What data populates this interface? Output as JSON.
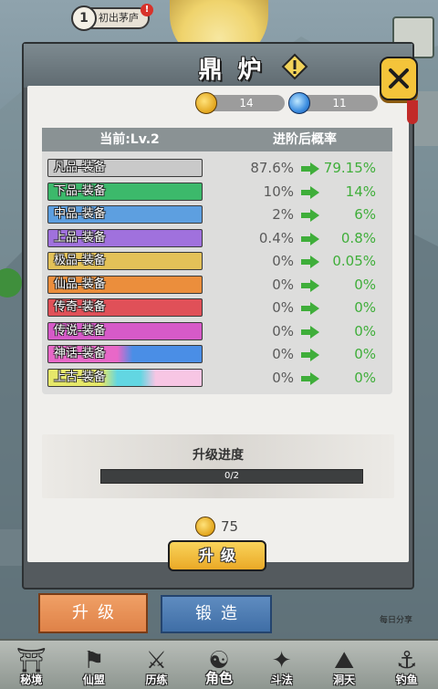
{
  "top": {
    "level_badge": "1",
    "badge_text": "初出茅庐",
    "notify": "!"
  },
  "panel": {
    "title": "鼎 炉"
  },
  "resources": [
    {
      "icon": "gold-coin-icon",
      "value": "14"
    },
    {
      "icon": "blue-gem-icon",
      "value": "11"
    }
  ],
  "table": {
    "header_left": "当前:Lv.2",
    "header_right": "进阶后概率",
    "rows": [
      {
        "label": "凡品-装备",
        "current": "87.6%",
        "next": "79.15%",
        "color": "#c9c9c9"
      },
      {
        "label": "下品-装备",
        "current": "10%",
        "next": "14%",
        "color": "#3cb96b"
      },
      {
        "label": "中品-装备",
        "current": "2%",
        "next": "6%",
        "color": "#5d9fe0"
      },
      {
        "label": "上品-装备",
        "current": "0.4%",
        "next": "0.8%",
        "color": "#a071dd"
      },
      {
        "label": "极品-装备",
        "current": "0%",
        "next": "0.05%",
        "color": "#e3c158"
      },
      {
        "label": "仙品-装备",
        "current": "0%",
        "next": "0%",
        "color": "#eb8e3c"
      },
      {
        "label": "传奇-装备",
        "current": "0%",
        "next": "0%",
        "color": "#e05058"
      },
      {
        "label": "传说-装备",
        "current": "0%",
        "next": "0%",
        "color": "#d65ac8"
      },
      {
        "label": "神话-装备",
        "current": "0%",
        "next": "0%",
        "color": "linear-gradient(90deg,#e868c8 0%,#e868c8 45%,#4a8ee6 55%,#4a8ee6 100%)"
      },
      {
        "label": "上古-装备",
        "current": "0%",
        "next": "0%",
        "color": "linear-gradient(90deg,#e6e86a 0%,#e6e86a 35%,#62d6e2 45%,#62d6e2 60%,#f7c6e4 70%,#f7c6e4 100%)"
      }
    ]
  },
  "progress": {
    "label": "升级进度",
    "text": "0/2",
    "fraction": 0
  },
  "cost": {
    "icon": "gold-coin-icon",
    "value": "75"
  },
  "upgrade_button": "升级",
  "tabs": {
    "upgrade": "升级",
    "forge": "锻造"
  },
  "share_text": "每日分享",
  "nav": [
    {
      "label": "秘境",
      "icon": "secret-realm-icon"
    },
    {
      "label": "仙盟",
      "icon": "alliance-icon"
    },
    {
      "label": "历练",
      "icon": "training-icon"
    },
    {
      "label": "角色",
      "icon": "character-icon",
      "active": true
    },
    {
      "label": "斗法",
      "icon": "duel-icon"
    },
    {
      "label": "洞天",
      "icon": "cave-icon"
    },
    {
      "label": "钓鱼",
      "icon": "fishing-icon"
    }
  ]
}
